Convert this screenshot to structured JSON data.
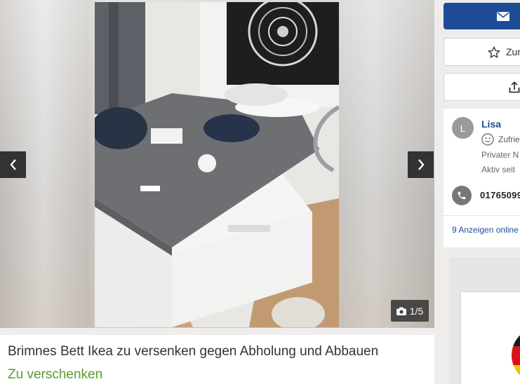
{
  "gallery": {
    "counter": "1/5",
    "prev_icon": "chevron-left-icon",
    "next_icon": "chevron-right-icon",
    "camera_icon": "camera-icon"
  },
  "ad": {
    "title": "Brimnes Bett Ikea zu versenken gegen Abholung und Abbauen",
    "price": "Zu verschenken"
  },
  "actions": {
    "contact_icon": "envelope-icon",
    "save_label": "Zur",
    "save_icon": "star-icon",
    "share_icon": "share-icon"
  },
  "seller": {
    "avatar_initial": "L",
    "name": "Lisa",
    "rating": "Zufrie",
    "type": "Privater N",
    "active_since": "Aktiv seit",
    "phone": "01765099",
    "ads_link": "9 Anzeigen online"
  },
  "colors": {
    "brand_blue": "#1d4b96",
    "price_green": "#5a9c2a",
    "overlay_dark": "#333333"
  }
}
